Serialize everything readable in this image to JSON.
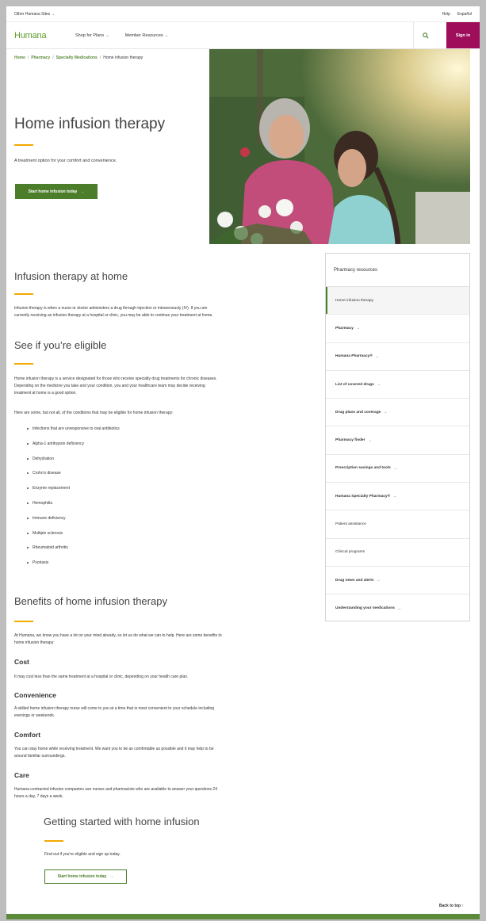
{
  "utility": {
    "other_sites": "Other Humana Sites",
    "help": "Help",
    "espanol": "Español"
  },
  "header": {
    "logo": "Humana",
    "nav": [
      "Shop for Plans",
      "Member Resources"
    ],
    "signin": "Sign in"
  },
  "breadcrumb": [
    "Home",
    "Pharmacy",
    "Specialty Medications",
    "Home infusion therapy"
  ],
  "hero": {
    "title": "Home infusion therapy",
    "subtitle": "A treatment option for your comfort and convenience.",
    "cta": "Start home infusion today"
  },
  "sections": {
    "s1_title": "Infusion therapy at home",
    "s1_p1": "Infusion therapy is when a nurse or doctor administers a drug through injection or intravenously (IV). If you are",
    "s1_p2": "currently receiving an infusion therapy at a hospital or clinic, you may be able to continue your treatment at home.",
    "s2_title": "See if you’re eligible",
    "s2_p1": "Home infusion therapy is a service designated for those who receive specialty drug treatments for chronic diseases.",
    "s2_p2": "Depending on the medicine you take and your condition, you and your healthcare team may decide receiving",
    "s2_p3": "treatment at home is a good option.",
    "s2_p4": "Here are some, but not all, of the conditions that may be eligible for home infusion therapy:",
    "conditions": [
      "Infections that are unresponsive to oral antibiotics",
      "Alpha-1 antitrypsin deficiency",
      "Dehydration",
      "Crohn’s disease",
      "Enzyme replacement",
      "Hemophilia",
      "Immune deficiency",
      "Multiple sclerosis",
      "Rheumatoid arthritis",
      "Psoriasis"
    ],
    "s3_title": "Benefits of home infusion therapy",
    "s3_p1": "At Humana, we know you have a lot on your mind already, so let us do what we can to help. Here are some benefits to",
    "s3_p2": "home infusion therapy:",
    "cost_h": "Cost",
    "cost_p": "It may cost less than the same treatment at a hospital or clinic, depending on your health care plan.",
    "conv_h": "Convenience",
    "conv_p1": "A skilled home infusion therapy nurse will come to you at a time that is most convenient to your schedule including",
    "conv_p2": "evenings or weekends.",
    "comfort_h": "Comfort",
    "comfort_p1": "You can stay home while receiving treatment. We want you to be as comfortable as possible and it may help to be",
    "comfort_p2": "around familiar surroundings.",
    "care_h": "Care",
    "care_p1": "Humana contracted infusion companies use nurses and pharmacists who are available to answer your questions 24",
    "care_p2": "hours a day, 7 days a week.",
    "s4_title": "Getting started with home infusion",
    "s4_p": "Find out if you’re eligible and sign up today.",
    "s4_cta": "Start home infusion today"
  },
  "sidebar": {
    "title": "Pharmacy resources",
    "items": [
      {
        "label": "Home infusion therapy"
      },
      {
        "label": "Pharmacy"
      },
      {
        "label": "Humana Pharmacy®"
      },
      {
        "label": "List of covered drugs"
      },
      {
        "label": "Drug plans and coverage"
      },
      {
        "label": "Pharmacy finder"
      },
      {
        "label": "Prescription savings and tools"
      },
      {
        "label": "Humana Specialty Pharmacy®"
      },
      {
        "label": "Patient assistance"
      },
      {
        "label": "Clinical programs"
      },
      {
        "label": "Drug news and alerts"
      },
      {
        "label": "Understanding your medications"
      }
    ]
  },
  "back_to_top": "Back to top",
  "colors": {
    "brand_green": "#5a9e2a",
    "button_green": "#4b7d2a",
    "signin_magenta": "#9e0e5a",
    "accent_orange": "#f2a900"
  }
}
